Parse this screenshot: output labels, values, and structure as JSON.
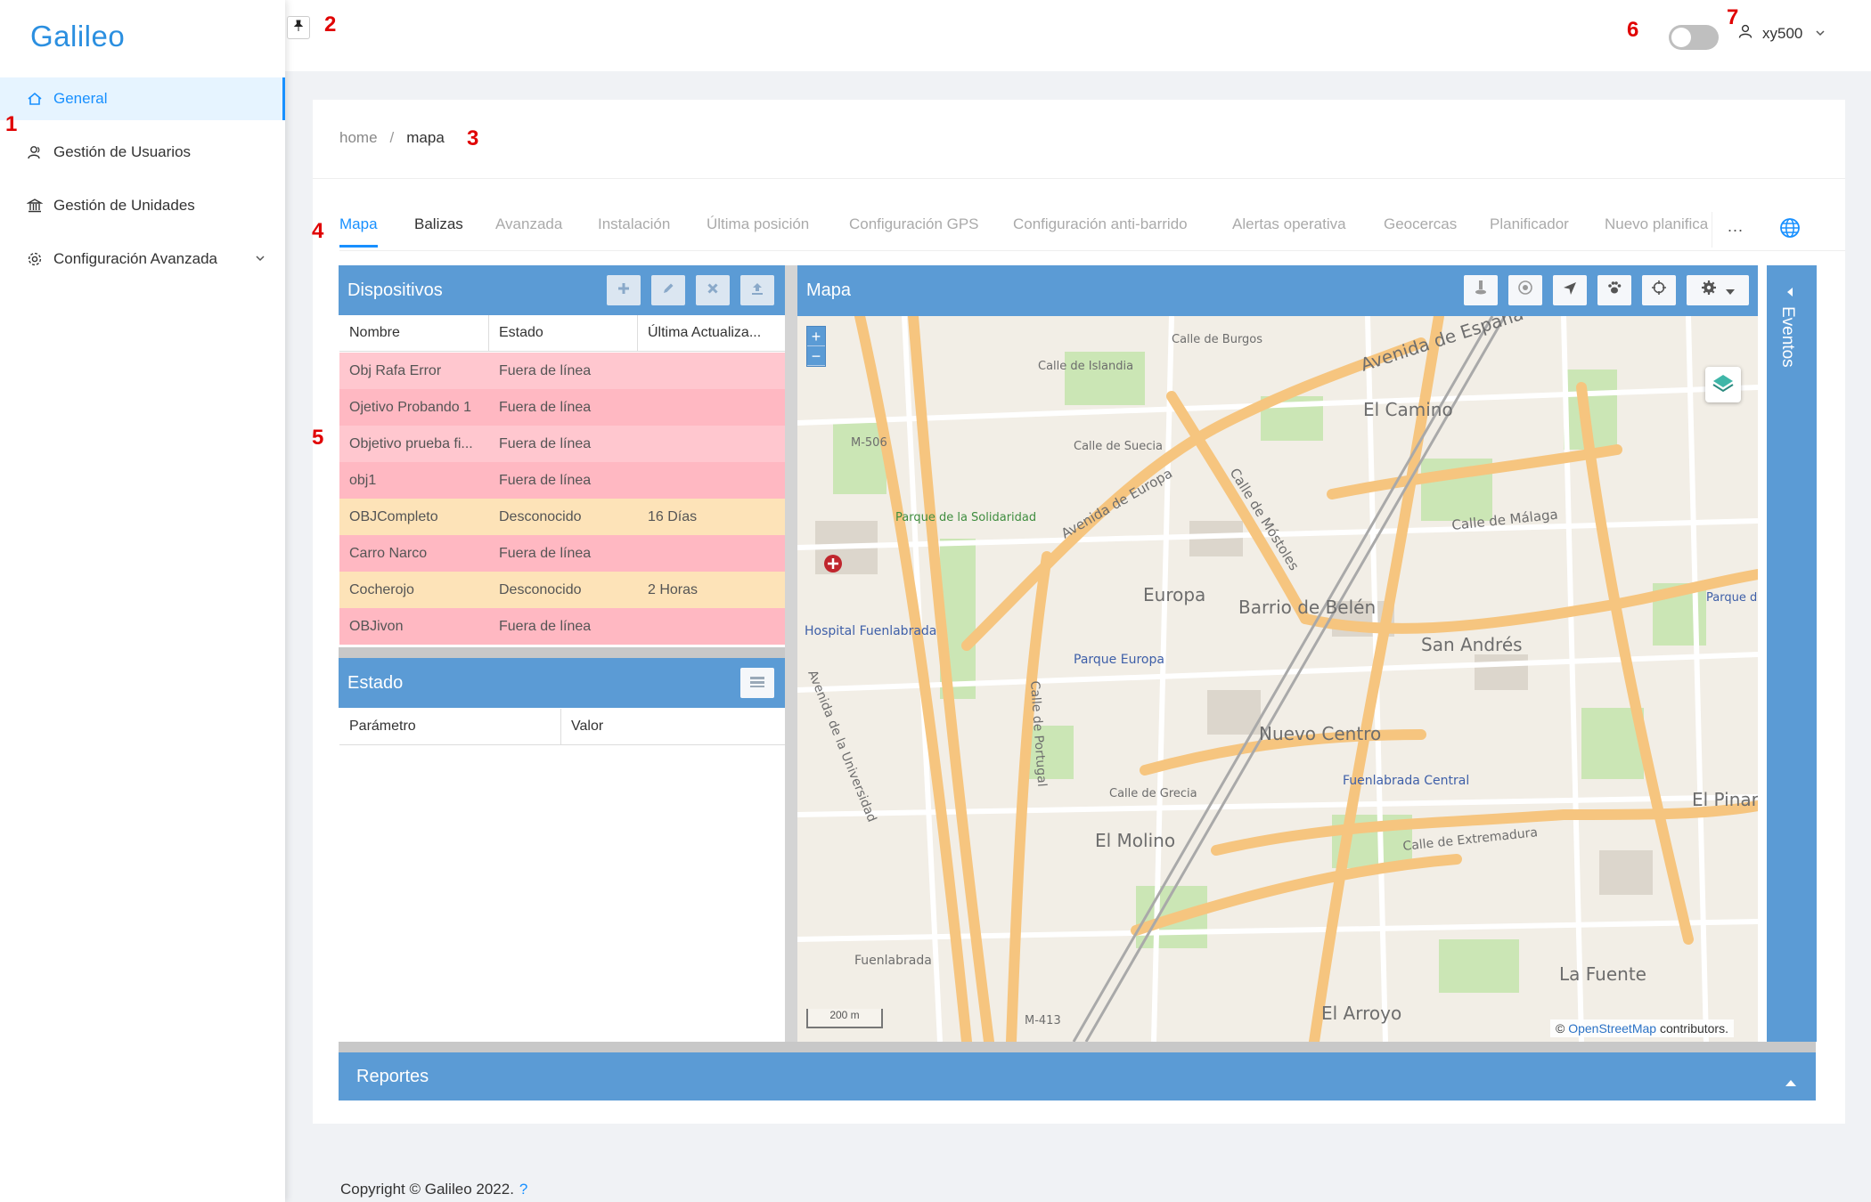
{
  "app": {
    "logo_text": "Galileo"
  },
  "sidebar": {
    "items": [
      {
        "label": "General",
        "icon": "home-icon",
        "active": true
      },
      {
        "label": "Gestión de Usuarios",
        "icon": "users-icon"
      },
      {
        "label": "Gestión de Unidades",
        "icon": "bank-icon"
      },
      {
        "label": "Configuración Avanzada",
        "icon": "gear-icon",
        "expandable": true
      }
    ]
  },
  "header": {
    "username": "xy500",
    "theme_toggle_on": false
  },
  "annotations": [
    "1",
    "2",
    "3",
    "4",
    "5",
    "6",
    "7"
  ],
  "breadcrumb": {
    "home": "home",
    "separator": "/",
    "current": "mapa"
  },
  "tabs": [
    "Mapa",
    "Balizas",
    "Avanzada",
    "Instalación",
    "Última posición",
    "Configuración GPS",
    "Configuración anti-barrido",
    "Alertas operativa",
    "Geocercas",
    "Planificador",
    "Nuevo planifica"
  ],
  "tabs_more": "···",
  "dispositivos": {
    "title": "Dispositivos",
    "columns": [
      "Nombre",
      "Estado",
      "Última Actualiza..."
    ],
    "rows": [
      {
        "nombre": "Obj Rafa Error",
        "estado": "Fuera de línea",
        "ultima": "",
        "status": "offline"
      },
      {
        "nombre": "Ojetivo Probando 1",
        "estado": "Fuera de línea",
        "ultima": "",
        "status": "offline"
      },
      {
        "nombre": "Objetivo prueba fi...",
        "estado": "Fuera de línea",
        "ultima": "",
        "status": "offline"
      },
      {
        "nombre": "obj1",
        "estado": "Fuera de línea",
        "ultima": "",
        "status": "offline"
      },
      {
        "nombre": "OBJCompleto",
        "estado": "Desconocido",
        "ultima": "16 Días",
        "status": "unknown"
      },
      {
        "nombre": "Carro Narco",
        "estado": "Fuera de línea",
        "ultima": "",
        "status": "offline"
      },
      {
        "nombre": "Cocherojo",
        "estado": "Desconocido",
        "ultima": "2 Horas",
        "status": "unknown"
      },
      {
        "nombre": "OBJivon",
        "estado": "Fuera de línea",
        "ultima": "",
        "status": "offline"
      }
    ]
  },
  "estado": {
    "title": "Estado",
    "columns": [
      "Parámetro",
      "Valor"
    ]
  },
  "mapa": {
    "title": "Mapa",
    "zoom_in": "+",
    "zoom_out": "−",
    "scale_label": "200 m",
    "attribution_prefix": "©",
    "attribution_link": "OpenStreetMap",
    "attribution_suffix": "contributors.",
    "labels": [
      "Avenida de España",
      "El Camino",
      "Calle de Burgos",
      "Calle de Islandia",
      "Calle de Suecia",
      "Avenida de Europa",
      "Calle de Móstoles",
      "Calle de Málaga",
      "Europa",
      "Barrio de Belén",
      "San Andrés",
      "Parque Europa",
      "Nuevo Centro",
      "Fuenlabrada Central",
      "El Molino",
      "Calle de Grecia",
      "Calle de Extremadura",
      "La Fuente",
      "El Arroyo",
      "Hospital Fuenlabrada",
      "Avenida de la Universidad",
      "Parque de la Solidaridad",
      "Calle de Portugal",
      "M-506",
      "M-413",
      "Fuenlabrada",
      "El Pinar",
      "Parque de los Estados"
    ]
  },
  "eventos": {
    "title": "Eventos"
  },
  "reportes": {
    "title": "Reportes"
  },
  "footer": {
    "text": "Copyright © Galileo 2022.",
    "help": "?"
  },
  "colors": {
    "primary": "#1890ff",
    "panel_header": "#5b9bd5",
    "row_offline": "#ffc7cf",
    "row_unknown": "#fde3b8",
    "map_road": "#f6c57f",
    "map_green": "#c9e8b8"
  }
}
